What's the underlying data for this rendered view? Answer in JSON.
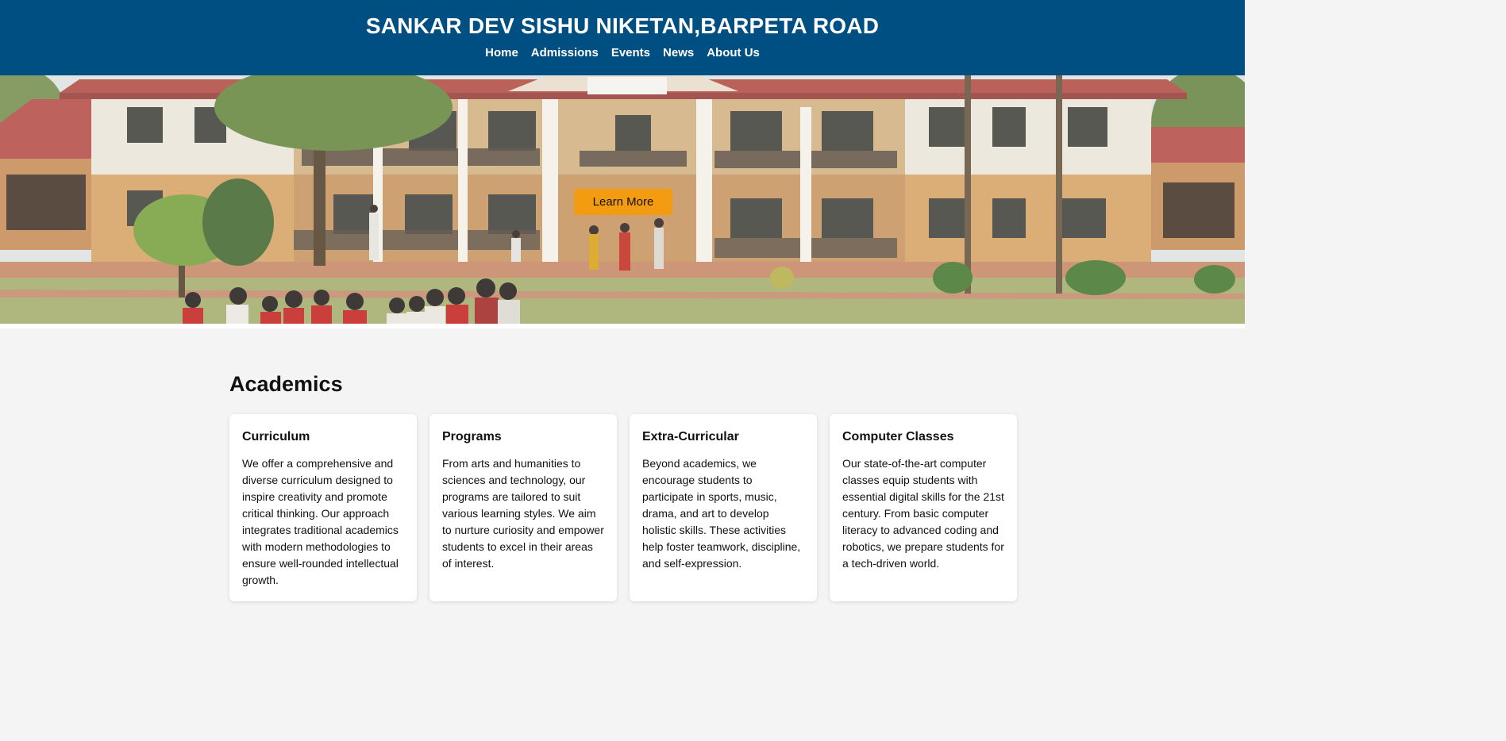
{
  "header": {
    "title": "SANKAR DEV SISHU NIKETAN,BARPETA ROAD",
    "nav": [
      {
        "label": "Home"
      },
      {
        "label": "Admissions"
      },
      {
        "label": "Events"
      },
      {
        "label": "News"
      },
      {
        "label": "About Us"
      }
    ]
  },
  "hero": {
    "image": "school-building-photo",
    "cta_label": "Learn More",
    "cta_color": "#f39c12"
  },
  "academics": {
    "heading": "Academics",
    "cards": [
      {
        "title": "Curriculum",
        "text": "We offer a comprehensive and diverse curriculum designed to inspire creativity and promote critical thinking. Our approach integrates traditional academics with modern methodologies to ensure well-rounded intellectual growth."
      },
      {
        "title": "Programs",
        "text": "From arts and humanities to sciences and technology, our programs are tailored to suit various learning styles. We aim to nurture curiosity and empower students to excel in their areas of interest."
      },
      {
        "title": "Extra-Curricular",
        "text": "Beyond academics, we encourage students to participate in sports, music, drama, and art to develop holistic skills. These activities help foster teamwork, discipline, and self-expression."
      },
      {
        "title": "Computer Classes",
        "text": "Our state-of-the-art computer classes equip students with essential digital skills for the 21st century. From basic computer literacy to advanced coding and robotics, we prepare students for a tech-driven world."
      }
    ]
  },
  "colors": {
    "header_bg": "#004f82",
    "page_bg": "#f4f4f4",
    "card_bg": "#ffffff"
  }
}
